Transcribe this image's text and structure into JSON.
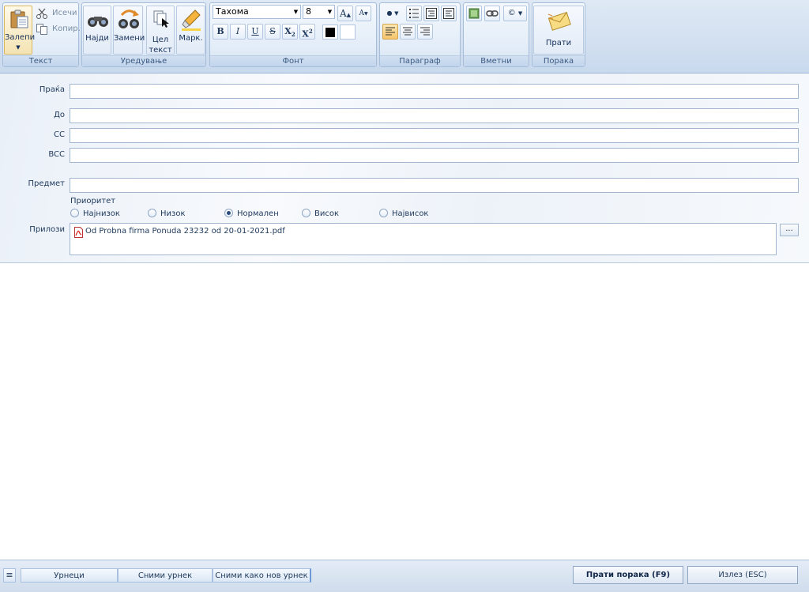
{
  "ribbon": {
    "groups": {
      "text": "Текст",
      "editing": "Уредување",
      "font": "Фонт",
      "paragraph": "Параграф",
      "insert": "Вметни",
      "message": "Порака"
    },
    "paste_label": "Залепи",
    "cut_label": "Исечи",
    "copy_label": "Копир.",
    "find_label": "Најди",
    "replace_label": "Замени",
    "select_all_line1": "Цел",
    "select_all_line2": "текст",
    "highlight_label": "Марк.",
    "font_name": "Тахома",
    "font_size": "8",
    "grow_font": "A",
    "shrink_font": "A",
    "bold": "B",
    "italic": "I",
    "underline": "U",
    "strike": "S",
    "subscript": "X",
    "superscript": "X",
    "send_label": "Прати",
    "symbol_label": "©",
    "colors": {
      "font_color": "#000000",
      "highlight_color": "#ffffff",
      "accent": "#f7c46a"
    }
  },
  "form": {
    "from_label": "Праќа",
    "to_label": "До",
    "cc_label": "CC",
    "bcc_label": "BCC",
    "subject_label": "Предмет",
    "priority_label": "Приоритет",
    "priorities": [
      "Најнизок",
      "Низок",
      "Нормален",
      "Висок",
      "Највисок"
    ],
    "selected_priority": "Нормален",
    "attachments_label": "Прилози",
    "attachment_file": "Od Probna firma Ponuda 23232 od 20-01-2021.pdf",
    "browse_label": "..."
  },
  "bottom": {
    "menu_icon": "≡",
    "tabs": [
      "Урнеци",
      "Сними урнек",
      "Сними како нов урнек"
    ],
    "send_button": "Прати порака (F9)",
    "exit_button": "Излез (ESC)"
  }
}
